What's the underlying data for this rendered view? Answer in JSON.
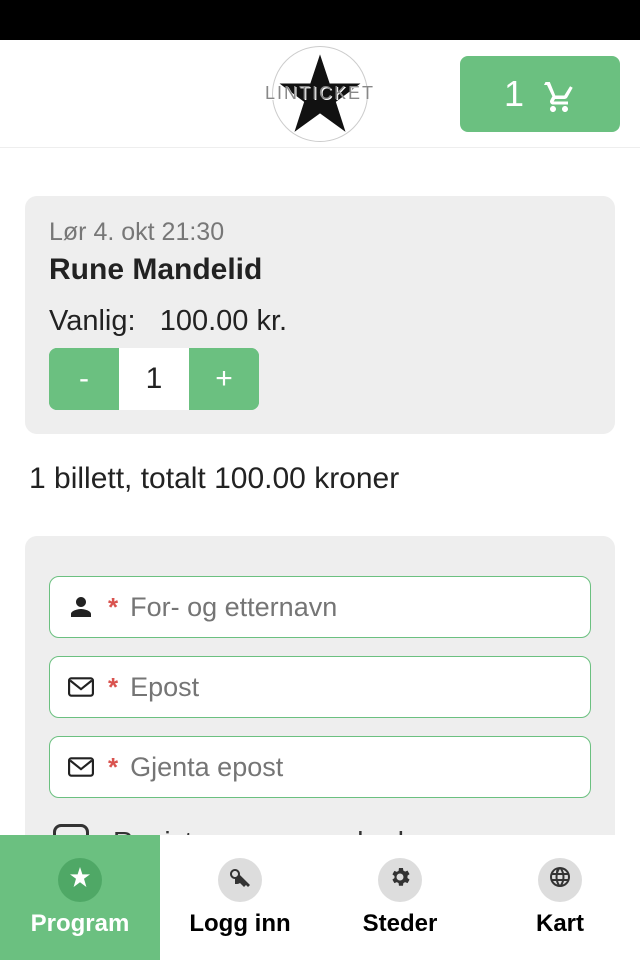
{
  "brand": {
    "name": "LINTICKET"
  },
  "cart": {
    "count": "1"
  },
  "event": {
    "date": "Lør 4. okt 21:30",
    "title": "Rune Mandelid",
    "ticket_type": "Vanlig:",
    "price": "100.00 kr.",
    "quantity": "1"
  },
  "summary_text": "1 billett, totalt 100.00 kroner",
  "form": {
    "name_ph": "For- og etternavn",
    "email_ph": "Epost",
    "email2_ph": "Gjenta epost",
    "register_label": "Registrer meg som bruker"
  },
  "nav": {
    "program": "Program",
    "login": "Logg inn",
    "places": "Steder",
    "map": "Kart"
  },
  "colors": {
    "accent": "#6BC080"
  }
}
